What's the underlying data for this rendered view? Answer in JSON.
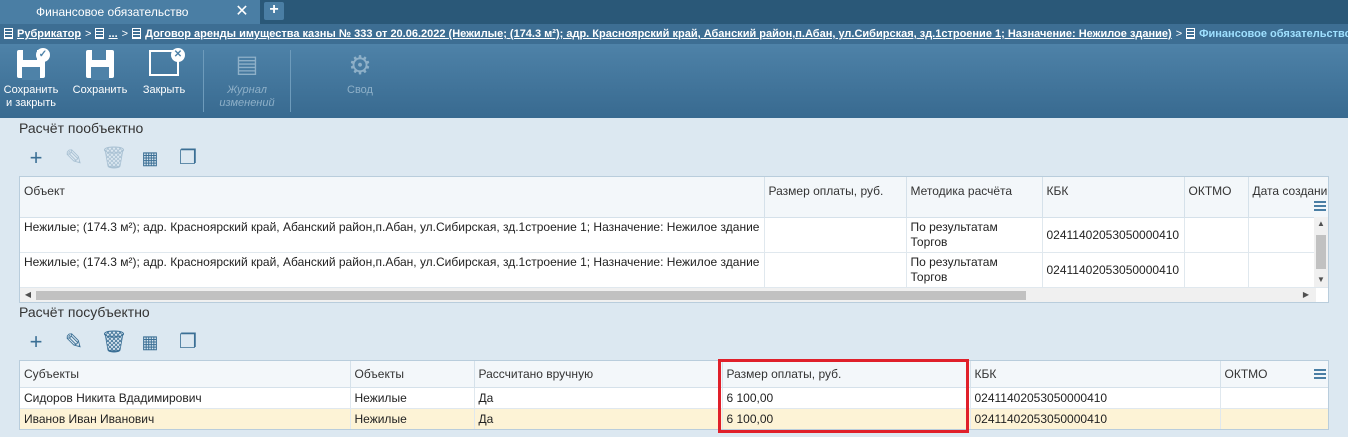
{
  "tab": {
    "title": "Финансовое обязательство",
    "close": "✕",
    "add": "+"
  },
  "breadcrumb": {
    "items": [
      {
        "label": "Рубрикатор"
      },
      {
        "label": "..."
      },
      {
        "label": "Договор аренды имущества казны № 333 от 20.06.2022 (Нежилые; (174.3 м²); адр. Красноярский край, Абанский район,п.Абан, ул.Сибирская, зд.1строение 1; Назначение: Нежилое здание)"
      }
    ],
    "current": "Финансовое обязательство",
    "separator": ">"
  },
  "toolbar": {
    "save_close": "Сохранить\nи закрыть",
    "save": "Сохранить",
    "close": "Закрыть",
    "journal": "Журнал\nизменений",
    "summary": "Свод"
  },
  "section1": {
    "title": "Расчёт пообъектно",
    "columns": [
      "Объект",
      "Размер оплаты, руб.",
      "Методика расчёта",
      "КБК",
      "ОКТМО",
      "Дата создани"
    ],
    "rows": [
      {
        "object": "Нежилые; (174.3 м²); адр. Красноярский край, Абанский район,п.Абан, ул.Сибирская, зд.1строение 1; Назначение: Нежилое здание",
        "amount": "",
        "method": "По результатам Торгов",
        "kbk": "02411402053050000410",
        "oktmo": "",
        "date": ""
      },
      {
        "object": "Нежилые; (174.3 м²); адр. Красноярский край, Абанский район,п.Абан, ул.Сибирская, зд.1строение 1; Назначение: Нежилое здание",
        "amount": "",
        "method": "По результатам Торгов",
        "kbk": "02411402053050000410",
        "oktmo": "",
        "date": ""
      }
    ]
  },
  "section2": {
    "title": "Расчёт посубъектно",
    "columns": [
      "Субъекты",
      "Объекты",
      "Рассчитано вручную",
      "Размер оплаты, руб.",
      "КБК",
      "ОКТМО"
    ],
    "rows": [
      {
        "subject": "Сидоров Никита Вдадимирович",
        "objects": "Нежилые",
        "manual": "Да",
        "amount": "6 100,00",
        "kbk": "02411402053050000410",
        "oktmo": ""
      },
      {
        "subject": "Иванов Иван Иванович",
        "objects": "Нежилые",
        "manual": "Да",
        "amount": "6 100,00",
        "kbk": "02411402053050000410",
        "oktmo": ""
      }
    ],
    "selected_row": 1
  },
  "icons": {
    "add": "plus-icon",
    "edit": "pencil-icon",
    "delete": "trash-icon",
    "table": "table-settings-icon",
    "copy": "copy-icon"
  }
}
